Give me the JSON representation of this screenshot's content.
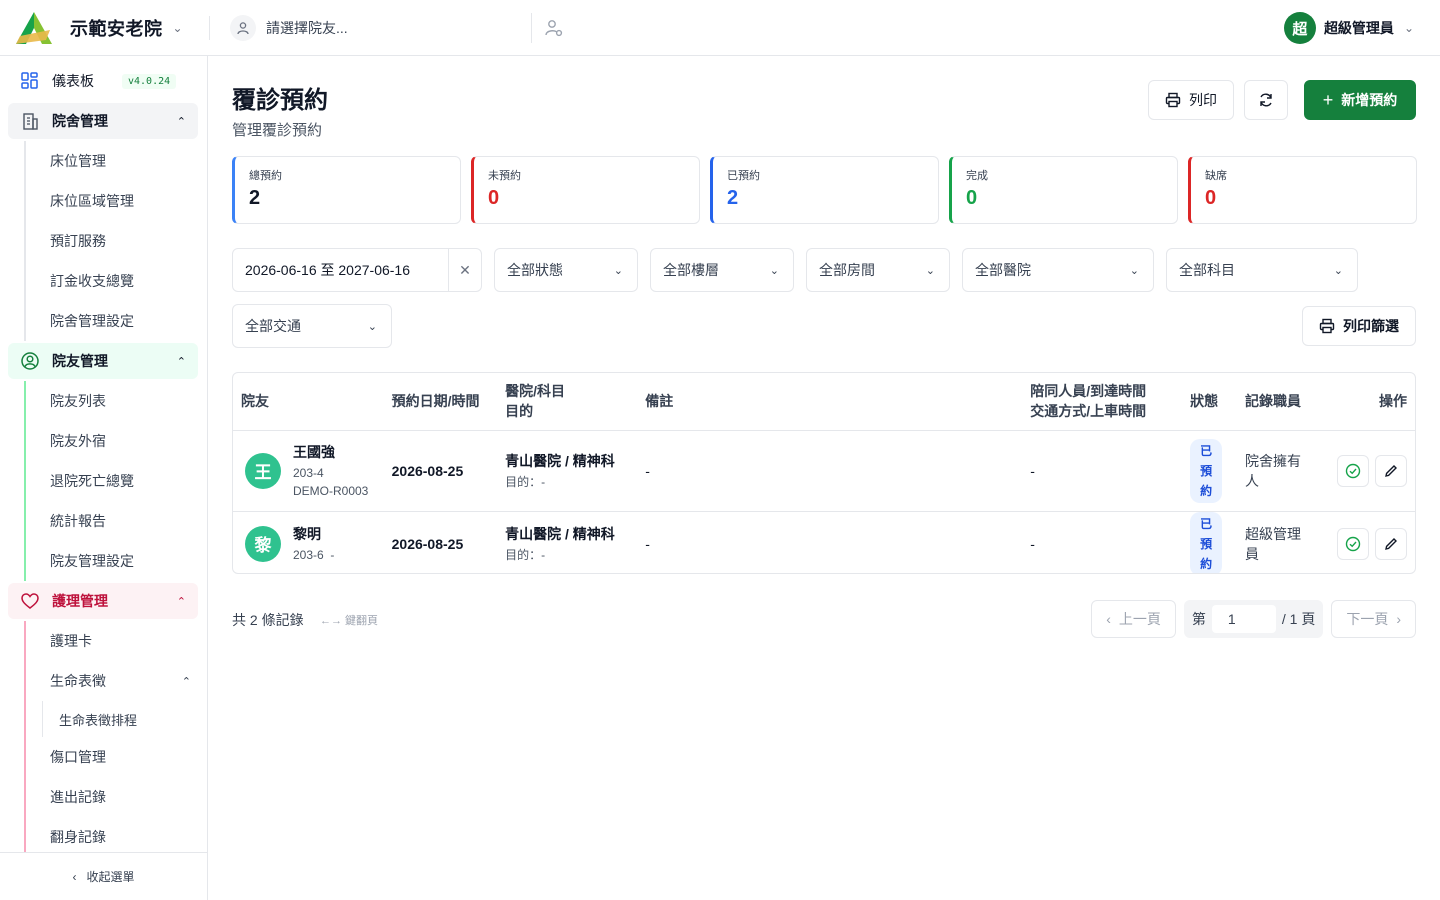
{
  "header": {
    "org_name": "示範安老院",
    "resident_placeholder": "請選擇院友...",
    "user_initial": "超",
    "user_name": "超級管理員"
  },
  "sidebar": {
    "dashboard_label": "儀表板",
    "version": "v4.0.24",
    "groups": [
      {
        "label": "院舍管理",
        "items": [
          "床位管理",
          "床位區域管理",
          "預訂服務",
          "訂金收支總覽",
          "院舍管理設定"
        ]
      },
      {
        "label": "院友管理",
        "items": [
          "院友列表",
          "院友外宿",
          "退院死亡總覽",
          "統計報告",
          "院友管理設定"
        ]
      },
      {
        "label": "護理管理",
        "items": [
          "護理卡",
          "生命表徵",
          "傷口管理",
          "進出記錄",
          "翻身記錄"
        ],
        "subitem": "生命表徵排程"
      }
    ],
    "collapse_label": "收起選單"
  },
  "page": {
    "title": "覆診預約",
    "subtitle": "管理覆診預約",
    "print_label": "列印",
    "add_label": "新增預約"
  },
  "stats": [
    {
      "label": "總預約",
      "value": "2",
      "color": "#3b82f6"
    },
    {
      "label": "未預約",
      "value": "0",
      "color": "#dc2626"
    },
    {
      "label": "已預約",
      "value": "2",
      "color": "#2563eb"
    },
    {
      "label": "完成",
      "value": "0",
      "color": "#16a34a"
    },
    {
      "label": "缺席",
      "value": "0",
      "color": "#dc2626"
    }
  ],
  "filters": {
    "date_range": "2026-06-16 至 2027-06-16",
    "status": "全部狀態",
    "floor": "全部樓層",
    "room": "全部房間",
    "hospital": "全部醫院",
    "department": "全部科目",
    "transport": "全部交通",
    "print_filter_label": "列印篩選"
  },
  "table": {
    "headers": {
      "resident": "院友",
      "datetime": "預約日期/時間",
      "hospital": "醫院/科目",
      "purpose": "目的",
      "remarks": "備註",
      "escort": "陪同人員/到達時間",
      "transport": "交通方式/上車時間",
      "status": "狀態",
      "staff": "記錄職員",
      "actions": "操作"
    },
    "rows": [
      {
        "initial": "王",
        "name": "王國強",
        "room": "203-4",
        "code": "DEMO-R0003",
        "date": "2026-08-25",
        "hospital": "青山醫院 / 精神科",
        "purpose": "目的：-",
        "remarks": "-",
        "escort": "-",
        "status": "已預約",
        "staff": "院舍擁有人"
      },
      {
        "initial": "黎",
        "name": "黎明",
        "room": "203-6",
        "code": "-",
        "date": "2026-08-25",
        "hospital": "青山醫院 / 精神科",
        "purpose": "目的：-",
        "remarks": "-",
        "escort": "-",
        "status": "已預約",
        "staff": "超級管理員"
      }
    ]
  },
  "footer": {
    "count_text": "共 2 條記錄",
    "kbd_hint": "←→ 鍵翻頁",
    "prev_label": "上一頁",
    "page_prefix": "第",
    "page_value": "1",
    "page_suffix": "/ 1 頁",
    "next_label": "下一頁"
  }
}
